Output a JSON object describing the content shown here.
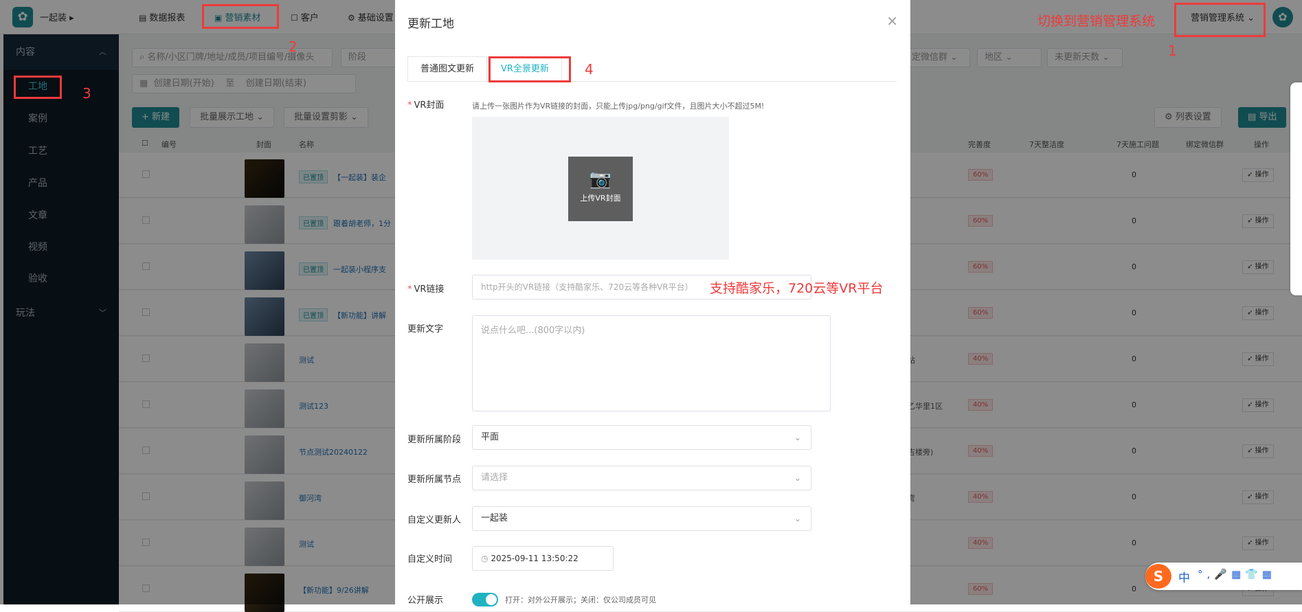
{
  "topbar": {
    "company": "一起装",
    "nav": [
      {
        "label": "数据报表",
        "icon": "chart-icon"
      },
      {
        "label": "营销素材",
        "icon": "folder-icon"
      },
      {
        "label": "客户",
        "icon": "contact-icon"
      },
      {
        "label": "基础设置",
        "icon": "gear-icon"
      }
    ],
    "system_select": "营销管理系统"
  },
  "sidebar": {
    "groups": [
      {
        "label": "内容"
      },
      {
        "label": "玩法"
      }
    ],
    "items": [
      {
        "label": "工地"
      },
      {
        "label": "案例"
      },
      {
        "label": "工艺"
      },
      {
        "label": "产品"
      },
      {
        "label": "文章"
      },
      {
        "label": "视频"
      },
      {
        "label": "验收"
      }
    ]
  },
  "filters": {
    "search_placeholder": "名称/小区门牌/地址/成员/项目编号/摄像头",
    "stage": "阶段",
    "wechat_group": "定微信群",
    "region": "地区",
    "days": "未更新天数",
    "date_start": "创建日期(开始)",
    "date_sep": "至",
    "date_end": "创建日期(结束)"
  },
  "toolbar": {
    "new": "+ 新建",
    "batch_show": "批量展示工地",
    "batch_clip": "批量设置剪影",
    "list_settings": "列表设置",
    "export": "导出"
  },
  "table": {
    "headers": [
      "编号",
      "封面",
      "名称",
      "完善度",
      "7天整洁度",
      "7天施工问题",
      "绑定微信群",
      "操作"
    ],
    "rows": [
      {
        "tag": "已置顶",
        "name": "【一起装】装企",
        "col2": "",
        "pct": "60%",
        "issues": "0",
        "thumb": "dark"
      },
      {
        "tag": "已置顶",
        "name": "跟着胡老师，1分",
        "col2": "",
        "pct": "60%",
        "issues": "0",
        "thumb": "normal"
      },
      {
        "tag": "已置顶",
        "name": "一起装小程序支",
        "col2": "",
        "pct": "60%",
        "issues": "0",
        "thumb": "blue"
      },
      {
        "tag": "已置顶",
        "name": "【新功能】讲解",
        "col2": "",
        "pct": "60%",
        "issues": "0",
        "thumb": "blue"
      },
      {
        "tag": "",
        "name": "测试",
        "col2": "站",
        "pct": "40%",
        "issues": "0",
        "thumb": "normal"
      },
      {
        "tag": "",
        "name": "测试123",
        "col2": "乙华里1区",
        "pct": "40%",
        "issues": "0",
        "thumb": "normal"
      },
      {
        "tag": "",
        "name": "节点测试20240122",
        "col2": "吉楼旁)",
        "pct": "40%",
        "issues": "0",
        "thumb": "normal"
      },
      {
        "tag": "",
        "name": "御河湾",
        "col2": "弯",
        "pct": "40%",
        "issues": "0",
        "thumb": "normal"
      },
      {
        "tag": "",
        "name": "测试",
        "col2": "",
        "pct": "40%",
        "issues": "0",
        "thumb": "normal"
      },
      {
        "tag": "",
        "name": "【新功能】9/26讲解",
        "col2": "",
        "pct": "60%",
        "issues": "0",
        "thumb": "dark"
      }
    ],
    "op_label": "操作"
  },
  "dialog": {
    "title": "更新工地",
    "tabs": [
      "普通图文更新",
      "VR全景更新"
    ],
    "vr_cover_label": "VR封面",
    "vr_cover_hint": "请上传一张图片作为VR链接的封面，只能上传jpg/png/gif文件，且图片大小不超过5M!",
    "upload_label": "上传VR封面",
    "vr_link_label": "VR链接",
    "vr_link_placeholder": "http开头的VR链接（支持酷家乐、720云等各种VR平台）",
    "text_label": "更新文字",
    "text_placeholder": "说点什么吧...(800字以内)",
    "stage_label": "更新所属阶段",
    "stage_value": "平面",
    "node_label": "更新所属节点",
    "node_placeholder": "请选择",
    "updater_label": "自定义更新人",
    "updater_value": "一起装",
    "time_label": "自定义时间",
    "time_value": "2025-09-11 13:50:22",
    "public_label": "公开展示",
    "public_hint": "打开：对外公开展示；关闭：仅公司成员可见"
  },
  "annotations": {
    "switch_hint": "切换到营销管理系统",
    "vr_hint": "支持酷家乐，720云等VR平台",
    "n1": "1",
    "n2": "2",
    "n3": "3",
    "n4": "4"
  },
  "ime": {
    "lang": "中",
    "s_logo": "S"
  }
}
